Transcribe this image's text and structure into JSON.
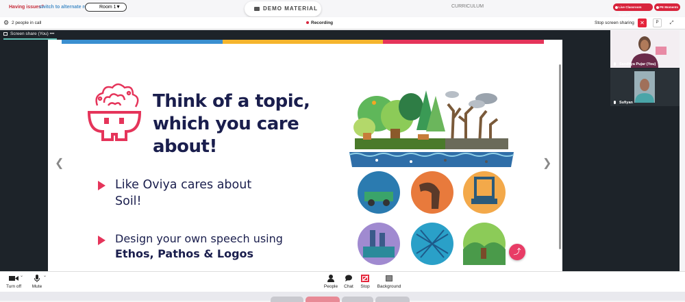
{
  "topbar": {
    "issues_text": "Having issues?",
    "alt_room_text": "switch to alternate room",
    "room_select": "Room 1",
    "demo_label": "DEMO MATERIAL",
    "curriculum_label": "CURRICULUM",
    "support_button": "Live Classroom Support",
    "moments_button": "PE Moments"
  },
  "callbar": {
    "people_count": "2 people in call",
    "recording_label": "Recording",
    "stop_sharing_label": "Stop screen sharing",
    "p_label": "P"
  },
  "stage": {
    "share_tab_label": "Screen share (You)",
    "share_tab_more": "•••"
  },
  "slide": {
    "title": "Think of a topic, which you care about!",
    "bullet1": "Like Oviya cares about Soil!",
    "bullet2_line1": "Design your own speech using",
    "bullet2_line2": "Ethos, Pathos & Logos",
    "stripe_colors": [
      "#3a8fd0",
      "#f5b52d",
      "#e5345a"
    ]
  },
  "participants": [
    {
      "name": "Sandhya Pujar (You)"
    },
    {
      "name": "Sufiyan"
    }
  ],
  "controls": {
    "camera": "Turn off",
    "mic": "Mute",
    "people": "People",
    "chat": "Chat",
    "stop": "Stop",
    "background": "Background"
  },
  "colors": {
    "accent_red": "#e5243b",
    "dark_bg": "#1d2329",
    "title_navy": "#1a1e4d",
    "bullet_pink": "#e5345a"
  }
}
